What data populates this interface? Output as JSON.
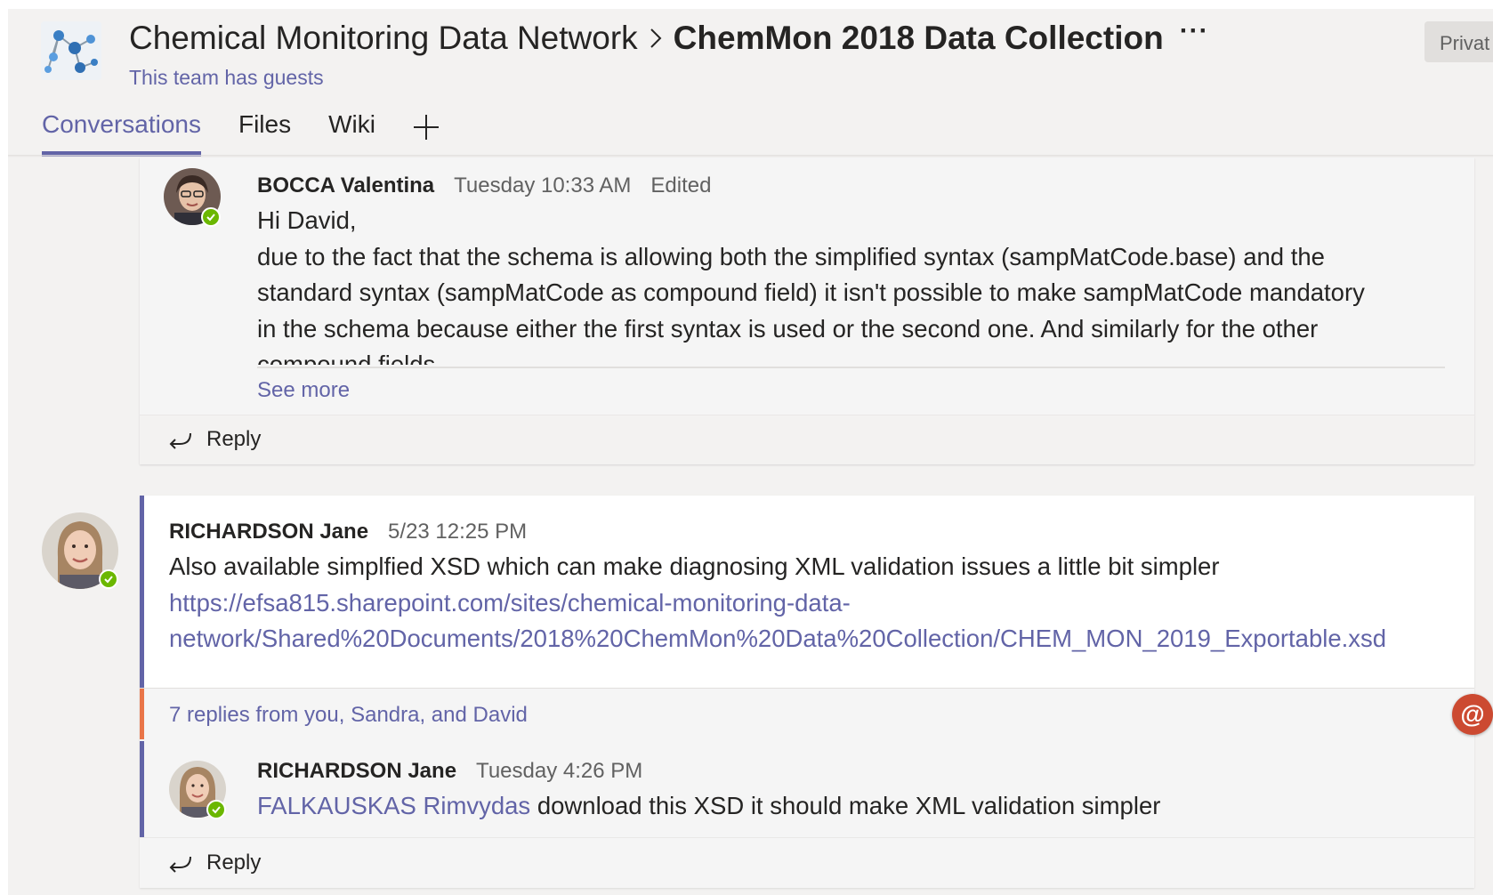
{
  "header": {
    "team_name": "Chemical Monitoring Data Network",
    "breadcrumb_separator_icon": "chevron-right-icon",
    "channel_name": "ChemMon 2018 Data Collection",
    "more_label": "···",
    "guests_notice": "This team has guests",
    "privacy_label": "Privat"
  },
  "tabs": [
    {
      "label": "Conversations",
      "active": true
    },
    {
      "label": "Files",
      "active": false
    },
    {
      "label": "Wiki",
      "active": false
    }
  ],
  "add_tab_icon": "plus-icon",
  "thread1": {
    "reply": {
      "author": "BOCCA Valentina",
      "time": "Tuesday 10:33 AM",
      "edited": "Edited",
      "greeting": "Hi David,",
      "line1": "due to the fact that the schema is allowing both the simplified syntax (sampMatCode.base) and the",
      "line2": "standard syntax (sampMatCode as compound field) it isn't possible to make sampMatCode mandatory",
      "line3": "in the schema because either the first syntax is used or the second one. And similarly for the other",
      "line4": "compound fields."
    },
    "see_more": "See more",
    "reply_label": "Reply"
  },
  "thread2": {
    "post": {
      "author": "RICHARDSON Jane",
      "time": "5/23 12:25 PM",
      "text": "Also available simplfied XSD which can make diagnosing XML validation issues a little bit simpler",
      "link_line1": "https://efsa815.sharepoint.com/sites/chemical-monitoring-data-",
      "link_line2": "network/Shared%20Documents/2018%20ChemMon%20Data%20Collection/CHEM_MON_2019_Exportable.xsd"
    },
    "replies_summary": "7 replies from you, Sandra, and David",
    "reply": {
      "author": "RICHARDSON Jane",
      "time": "Tuesday 4:26 PM",
      "mention": "FALKAUSKAS Rimvydas",
      "text": " download this XSD it should make XML validation simpler"
    },
    "reply_label": "Reply"
  },
  "mention_badge": "@",
  "colors": {
    "brand": "#6264a7",
    "presence": "#6bb700",
    "new_indicator": "#e97548",
    "mention_badge": "#cc4a31"
  }
}
